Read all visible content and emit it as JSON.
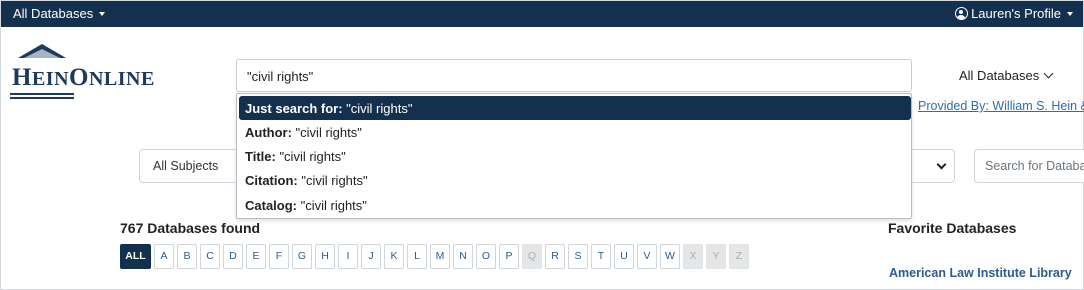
{
  "topnav": {
    "databases_label": "All Databases",
    "profile_label": "Lauren's Profile"
  },
  "logo": {
    "text": "HeinOnline"
  },
  "search": {
    "value": "\"civil rights\"",
    "scope_label": "All Databases"
  },
  "provided_by": "Provided By: William S. Hein &",
  "autocomplete": [
    {
      "prefix": "Just search for:",
      "term": " \"civil rights\"",
      "active": true
    },
    {
      "prefix": "Author:",
      "term": " \"civil rights\"",
      "active": false
    },
    {
      "prefix": "Title:",
      "term": " \"civil rights\"",
      "active": false
    },
    {
      "prefix": "Citation:",
      "term": " \"civil rights\"",
      "active": false
    },
    {
      "prefix": "Catalog:",
      "term": " \"civil rights\"",
      "active": false
    }
  ],
  "filters": {
    "subjects_label": "All Subjects",
    "search_databases_placeholder": "Search for Databa"
  },
  "results": {
    "count_label": "767 Databases found",
    "favorites_heading": "Favorite Databases",
    "favorite_link": "American Law Institute Library"
  },
  "alphabet": {
    "letters": [
      "ALL",
      "A",
      "B",
      "C",
      "D",
      "E",
      "F",
      "G",
      "H",
      "I",
      "J",
      "K",
      "L",
      "M",
      "N",
      "O",
      "P",
      "Q",
      "R",
      "S",
      "T",
      "U",
      "V",
      "W",
      "X",
      "Y",
      "Z"
    ],
    "disabled": [
      "Q",
      "X",
      "Y",
      "Z"
    ],
    "selected": "ALL"
  },
  "colors": {
    "navy": "#14304f",
    "link_blue": "#2a6fb0"
  }
}
